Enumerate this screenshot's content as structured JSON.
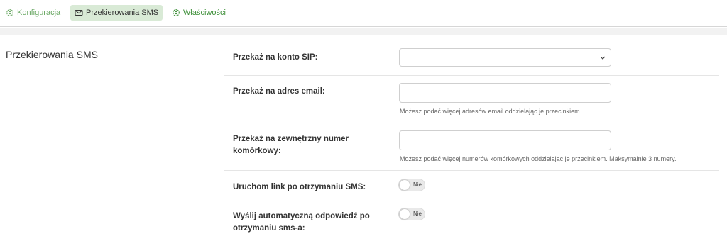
{
  "tabs": [
    {
      "label": "Konfiguracja",
      "icon": "gear-icon"
    },
    {
      "label": "Przekierowania SMS",
      "icon": "envelope-icon"
    },
    {
      "label": "Właściwości",
      "icon": "gear-icon"
    }
  ],
  "section": {
    "title": "Przekierowania SMS"
  },
  "form": {
    "sip": {
      "label": "Przekaż na konto SIP:",
      "value": ""
    },
    "email": {
      "label": "Przekaż na adres email:",
      "value": "",
      "help": "Możesz podać więcej adresów email oddzielając je przecinkiem."
    },
    "mobile": {
      "label": "Przekaż na zewnętrzny numer komórkowy:",
      "value": "",
      "help": "Możesz podać więcej numerów komórkowych oddzielając je przecinkiem. Maksymalnie 3 numery."
    },
    "link": {
      "label": "Uruchom link po otrzymaniu SMS:",
      "toggle": "Nie"
    },
    "autoreply": {
      "label": "Wyślij automatyczną odpowiedź po otrzymaniu sms-a:",
      "toggle": "Nie"
    }
  },
  "colors": {
    "accent": "#4a9a44",
    "active_tab_bg": "#d9ead6"
  }
}
